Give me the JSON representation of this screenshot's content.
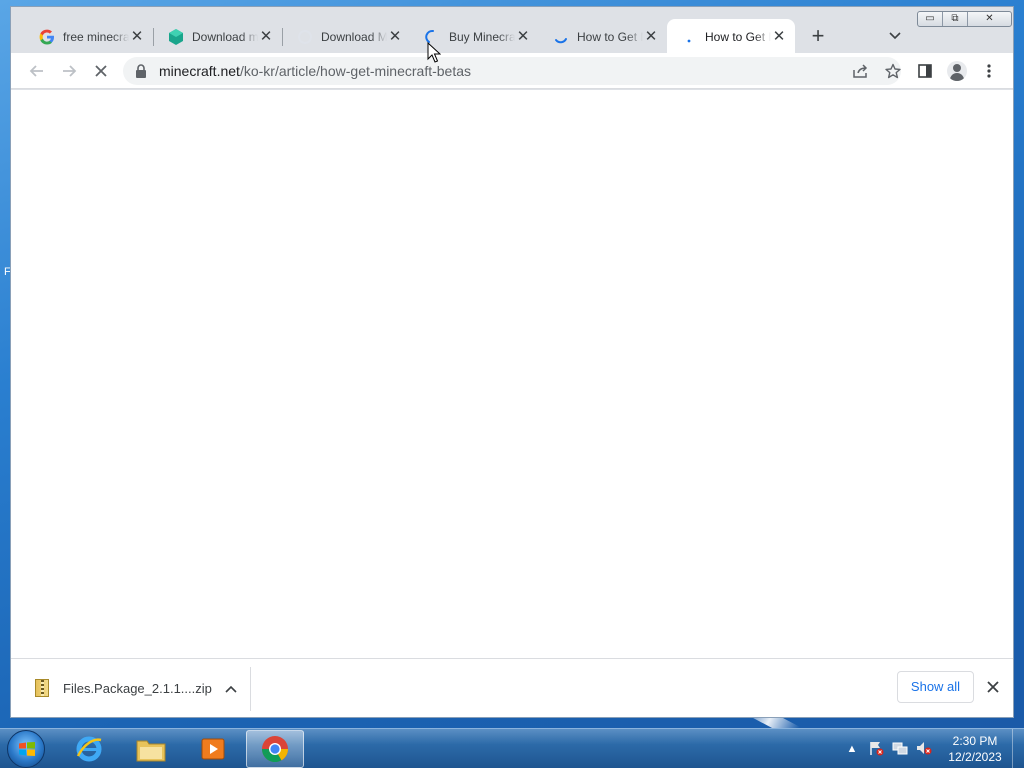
{
  "desktop": {
    "edge_glyph": "F"
  },
  "window": {
    "controls": {
      "minimize": "▭",
      "maximize": "⧉",
      "close": "✕"
    }
  },
  "tabs": [
    {
      "title": "free minecraft",
      "icon": "google-icon",
      "active": false
    },
    {
      "title": "Download minecraft",
      "icon": "diamond-icon",
      "active": false
    },
    {
      "title": "Download Minecraft",
      "icon": "loading-icon",
      "active": false
    },
    {
      "title": "Buy Minecraft",
      "icon": "loading-spinner-icon",
      "active": false
    },
    {
      "title": "How to Get Minecraft",
      "icon": "loading-spinner-icon",
      "active": false
    },
    {
      "title": "How to Get Minecraft",
      "icon": "loading-dot-icon",
      "active": true
    }
  ],
  "tab_close_glyph": "✕",
  "new_tab_glyph": "+",
  "tab_search_glyph": "⌄",
  "toolbar": {
    "url_host": "minecraft.net",
    "url_path": "/ko-kr/article/how-get-minecraft-betas"
  },
  "downloads": {
    "items": [
      {
        "name": "Files.Package_2.1.1....zip"
      }
    ],
    "show_all_label": "Show all"
  },
  "taskbar": {
    "apps": [
      "internet-explorer",
      "file-explorer",
      "media-player",
      "chrome"
    ],
    "clock_time": "2:30 PM",
    "clock_date": "12/2/2023"
  },
  "colors": {
    "tab_strip": "#dee1e6",
    "accent": "#1a73e8",
    "taskbar": "#2c6aa8"
  }
}
